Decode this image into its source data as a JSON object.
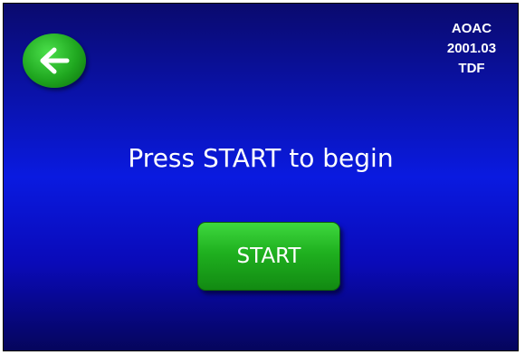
{
  "header": {
    "back_icon": "arrow-left-icon",
    "test_id_lines": [
      "AOAC",
      "2001.03",
      "TDF"
    ]
  },
  "main": {
    "prompt": "Press START to begin",
    "start_label": "START"
  },
  "colors": {
    "background_top": "#0a0a6e",
    "background_mid": "#0a1ae0",
    "background_bottom": "#05055c",
    "button_green": "#1fb01f",
    "text": "#ffffff"
  }
}
